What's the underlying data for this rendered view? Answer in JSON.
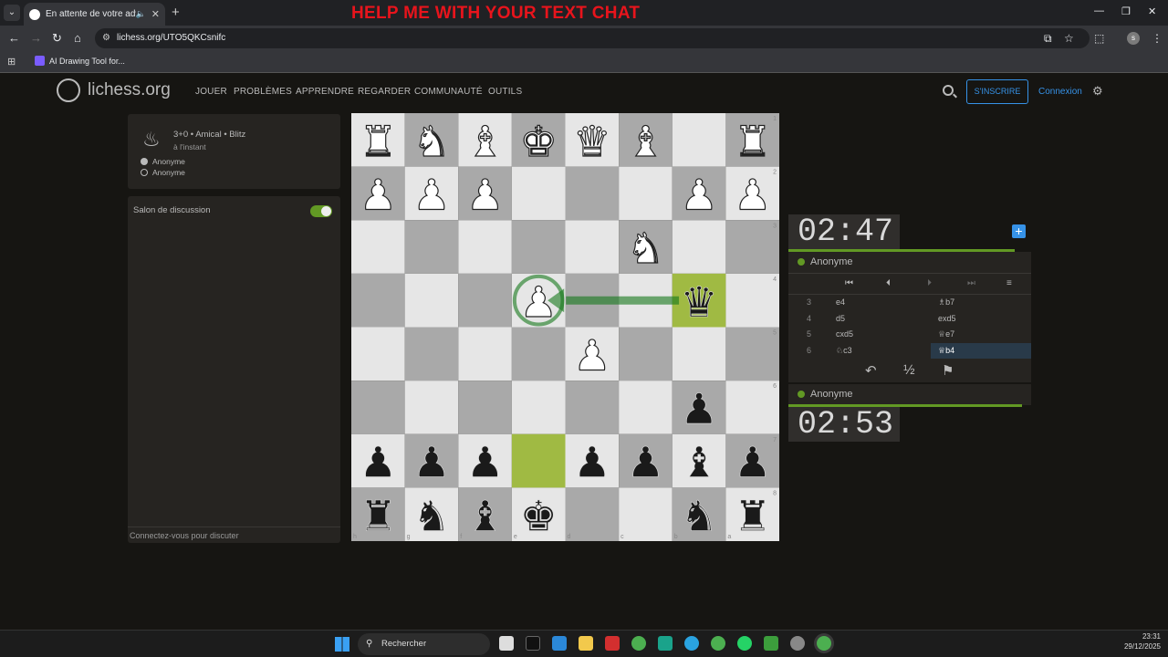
{
  "browser": {
    "tab_title": "En attente de votre advers",
    "url": "lichess.org/UTO5QKCsnifc",
    "bookmark": "AI Drawing Tool for..."
  },
  "banner": "HELP ME WITH YOUR TEXT CHAT",
  "site": {
    "logo": "lichess.org",
    "nav": [
      "JOUER",
      "PROBLÈMES",
      "APPRENDRE",
      "REGARDER",
      "COMMUNAUTÉ",
      "OUTILS"
    ],
    "signup": "S'INSCRIRE",
    "login": "Connexion"
  },
  "game_meta": {
    "title": "3+0 • Amical • Blitz",
    "time": "à l'instant",
    "players": [
      "Anonyme",
      "Anonyme"
    ]
  },
  "chat": {
    "title": "Salon de discussion",
    "footer": "Connectez-vous pour discuter",
    "enabled": true
  },
  "board": {
    "orientation": "black",
    "files": [
      "h",
      "g",
      "f",
      "e",
      "d",
      "c",
      "b",
      "a"
    ],
    "ranks": [
      "1",
      "2",
      "3",
      "4",
      "5",
      "6",
      "7",
      "8"
    ],
    "rows": [
      [
        "wR",
        "wN",
        "wB",
        "wK",
        "wQ",
        "wB",
        "",
        "wR"
      ],
      [
        "wP",
        "wP",
        "wP",
        "",
        "",
        "",
        "wP",
        "wP"
      ],
      [
        "",
        "",
        "",
        "",
        "",
        "wN",
        "",
        ""
      ],
      [
        "",
        "",
        "",
        "wP",
        "",
        "",
        "bQ",
        ""
      ],
      [
        "",
        "",
        "",
        "",
        "wP",
        "",
        "",
        ""
      ],
      [
        "",
        "",
        "",
        "",
        "",
        "",
        "bP",
        ""
      ],
      [
        "bP",
        "bP",
        "bP",
        "",
        "bP",
        "bP",
        "bB",
        "bP"
      ],
      [
        "bR",
        "bN",
        "bB",
        "bK",
        "",
        "",
        "bN",
        "bR"
      ]
    ],
    "highlight": [
      "e7",
      "b4"
    ],
    "arrow": {
      "from": "b4",
      "to": "e4"
    },
    "colors": {
      "light": "#e6e6e6",
      "dark": "#a9a9a9",
      "highlight": "#9bc700",
      "arrow": "#15781b"
    }
  },
  "clocks": {
    "top": "02:47",
    "bottom": "02:53"
  },
  "players": {
    "top": "Anonyme",
    "bottom": "Anonyme"
  },
  "moves": [
    {
      "n": "3",
      "w": "e4",
      "b": "♗b7"
    },
    {
      "n": "4",
      "w": "d5",
      "b": "exd5"
    },
    {
      "n": "5",
      "w": "cxd5",
      "b": "♕e7"
    },
    {
      "n": "6",
      "w": "♘c3",
      "b": "♕b4"
    }
  ],
  "controls": {
    "takeback": "↶",
    "draw": "½",
    "resign": "⚑"
  },
  "taskbar": {
    "search": "Rechercher",
    "time": "23:31",
    "date": "29/12/2025"
  }
}
